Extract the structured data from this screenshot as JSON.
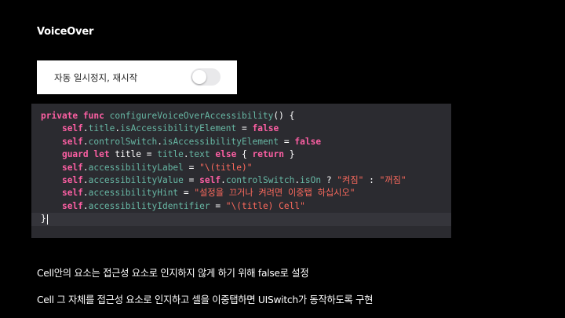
{
  "slide": {
    "title": "VoiceOver",
    "descriptions": [
      "Cell안의 요소는 접근성 요소로 인지하지 않게 하기 위해 false로 설정",
      "Cell 그 자체를 접근성 요소로 인지하고 셀을 이중탭하면 UISwitch가 동작하도록 구현"
    ]
  },
  "cell_preview": {
    "label": "자동 일시정지, 재시작",
    "toggle_on": false
  },
  "code": {
    "indent": "    ",
    "lines": [
      [
        {
          "t": "kw",
          "v": "private"
        },
        {
          "t": "plain",
          "v": " "
        },
        {
          "t": "kw",
          "v": "func"
        },
        {
          "t": "plain",
          "v": " "
        },
        {
          "t": "fn",
          "v": "configureVoiceOverAccessibility"
        },
        {
          "t": "plain",
          "v": "() {"
        }
      ],
      [
        {
          "t": "plain",
          "v": "    "
        },
        {
          "t": "kw",
          "v": "self"
        },
        {
          "t": "plain",
          "v": "."
        },
        {
          "t": "prop",
          "v": "title"
        },
        {
          "t": "plain",
          "v": "."
        },
        {
          "t": "prop",
          "v": "isAccessibilityElement"
        },
        {
          "t": "plain",
          "v": " = "
        },
        {
          "t": "kw",
          "v": "false"
        }
      ],
      [
        {
          "t": "plain",
          "v": "    "
        },
        {
          "t": "kw",
          "v": "self"
        },
        {
          "t": "plain",
          "v": "."
        },
        {
          "t": "prop",
          "v": "controlSwitch"
        },
        {
          "t": "plain",
          "v": "."
        },
        {
          "t": "prop",
          "v": "isAccessibilityElement"
        },
        {
          "t": "plain",
          "v": " = "
        },
        {
          "t": "kw",
          "v": "false"
        }
      ],
      [
        {
          "t": "plain",
          "v": "    "
        },
        {
          "t": "kw",
          "v": "guard"
        },
        {
          "t": "plain",
          "v": " "
        },
        {
          "t": "kw",
          "v": "let"
        },
        {
          "t": "plain",
          "v": " title = "
        },
        {
          "t": "prop",
          "v": "title"
        },
        {
          "t": "plain",
          "v": "."
        },
        {
          "t": "prop",
          "v": "text"
        },
        {
          "t": "plain",
          "v": " "
        },
        {
          "t": "kw",
          "v": "else"
        },
        {
          "t": "plain",
          "v": " { "
        },
        {
          "t": "kw",
          "v": "return"
        },
        {
          "t": "plain",
          "v": " }"
        }
      ],
      [
        {
          "t": "plain",
          "v": "    "
        },
        {
          "t": "kw",
          "v": "self"
        },
        {
          "t": "plain",
          "v": "."
        },
        {
          "t": "prop",
          "v": "accessibilityLabel"
        },
        {
          "t": "plain",
          "v": " = "
        },
        {
          "t": "str",
          "v": "\"\\(title)\""
        }
      ],
      [
        {
          "t": "plain",
          "v": "    "
        },
        {
          "t": "kw",
          "v": "self"
        },
        {
          "t": "plain",
          "v": "."
        },
        {
          "t": "prop",
          "v": "accessibilityValue"
        },
        {
          "t": "plain",
          "v": " = "
        },
        {
          "t": "kw",
          "v": "self"
        },
        {
          "t": "plain",
          "v": "."
        },
        {
          "t": "prop",
          "v": "controlSwitch"
        },
        {
          "t": "plain",
          "v": "."
        },
        {
          "t": "prop",
          "v": "isOn"
        },
        {
          "t": "plain",
          "v": " ? "
        },
        {
          "t": "str",
          "v": "\"켜짐\""
        },
        {
          "t": "plain",
          "v": " : "
        },
        {
          "t": "str",
          "v": "\"꺼짐\""
        }
      ],
      [
        {
          "t": "plain",
          "v": "    "
        },
        {
          "t": "kw",
          "v": "self"
        },
        {
          "t": "plain",
          "v": "."
        },
        {
          "t": "prop",
          "v": "accessibilityHint"
        },
        {
          "t": "plain",
          "v": " = "
        },
        {
          "t": "str",
          "v": "\"설정을 끄거나 켜려면 이중탭 하십시오\""
        }
      ],
      [
        {
          "t": "plain",
          "v": "    "
        },
        {
          "t": "kw",
          "v": "self"
        },
        {
          "t": "plain",
          "v": "."
        },
        {
          "t": "prop",
          "v": "accessibilityIdentifier"
        },
        {
          "t": "plain",
          "v": " = "
        },
        {
          "t": "str",
          "v": "\"\\(title) Cell\""
        }
      ],
      [
        {
          "t": "plain",
          "v": "}"
        }
      ]
    ],
    "current_line": 8
  }
}
